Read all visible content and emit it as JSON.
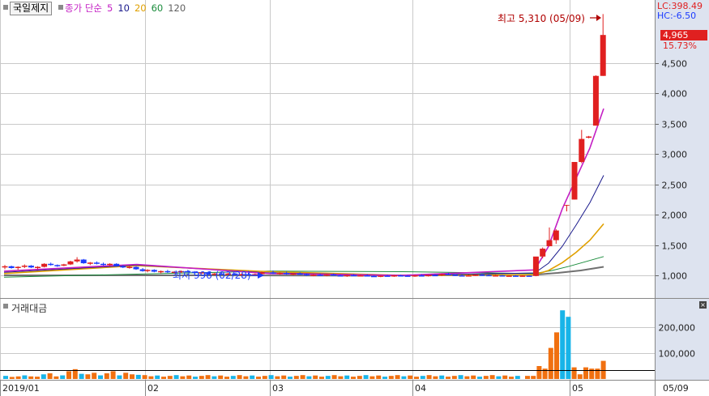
{
  "header": {
    "stock_name": "국일제지",
    "ma_label": "종가 단순",
    "periods": [
      {
        "label": "5",
        "color": "#c41fc4"
      },
      {
        "label": "10",
        "color": "#1a1a8c"
      },
      {
        "label": "20",
        "color": "#e0a000"
      },
      {
        "label": "60",
        "color": "#1a8c3c"
      },
      {
        "label": "120",
        "color": "#606060"
      }
    ]
  },
  "info": {
    "lc": "LC:398.49",
    "hc": "HC:-6.50",
    "current_price": "4,965",
    "change_pct": "15.73%",
    "high_label": "최고 5,310 (05/09)",
    "low_label": "최저 996 (02/28)"
  },
  "volume_panel": {
    "title": "거래대금"
  },
  "colors": {
    "up": "#e02020",
    "down": "#1c3cff",
    "grid": "#c9c9c9",
    "axis_bg": "#dde3ef"
  },
  "chart_data": {
    "type": "candlestick",
    "title": "",
    "x_ticks": [
      "2019/01",
      "02",
      "03",
      "04",
      "05",
      "05/09"
    ],
    "price_axis": {
      "ticks": [
        1000,
        1500,
        2000,
        2500,
        3000,
        3500,
        4000,
        4500
      ],
      "range": [
        700,
        5400
      ]
    },
    "volume_axis": {
      "ticks": [
        100000,
        200000
      ],
      "range": [
        0,
        285000
      ]
    },
    "candles_jan": [
      [
        1130,
        1170,
        1100,
        1150
      ],
      [
        1150,
        1160,
        1110,
        1120
      ],
      [
        1120,
        1150,
        1090,
        1140
      ],
      [
        1140,
        1180,
        1120,
        1160
      ],
      [
        1160,
        1170,
        1120,
        1130
      ],
      [
        1130,
        1150,
        1100,
        1140
      ],
      [
        1140,
        1200,
        1130,
        1190
      ],
      [
        1190,
        1210,
        1160,
        1170
      ],
      [
        1170,
        1180,
        1140,
        1160
      ],
      [
        1160,
        1190,
        1150,
        1180
      ],
      [
        1180,
        1240,
        1170,
        1230
      ],
      [
        1230,
        1300,
        1210,
        1260
      ],
      [
        1260,
        1270,
        1190,
        1200
      ],
      [
        1200,
        1220,
        1170,
        1210
      ],
      [
        1210,
        1230,
        1180,
        1190
      ],
      [
        1190,
        1210,
        1160,
        1170
      ],
      [
        1170,
        1200,
        1150,
        1190
      ],
      [
        1190,
        1200,
        1140,
        1150
      ],
      [
        1150,
        1170,
        1120,
        1130
      ],
      [
        1130,
        1160,
        1110,
        1140
      ],
      [
        1140,
        1150,
        1090,
        1100
      ],
      [
        1100,
        1120,
        1060,
        1070
      ]
    ],
    "candles_feb": [
      [
        1070,
        1100,
        1050,
        1090
      ],
      [
        1090,
        1100,
        1050,
        1060
      ],
      [
        1060,
        1080,
        1030,
        1070
      ],
      [
        1070,
        1090,
        1040,
        1050
      ],
      [
        1050,
        1070,
        1030,
        1060
      ],
      [
        1060,
        1080,
        1040,
        1070
      ],
      [
        1070,
        1090,
        1050,
        1060
      ],
      [
        1060,
        1070,
        1030,
        1040
      ],
      [
        1040,
        1060,
        1020,
        1050
      ],
      [
        1050,
        1060,
        1010,
        1020
      ],
      [
        1020,
        1040,
        1000,
        1030
      ],
      [
        1030,
        1050,
        1010,
        1020
      ],
      [
        1020,
        1040,
        1000,
        1030
      ],
      [
        1030,
        1040,
        996,
        1005
      ],
      [
        1005,
        1030,
        996,
        1020
      ],
      [
        1020,
        1040,
        1000,
        1010
      ],
      [
        1010,
        1030,
        995,
        1020
      ],
      [
        1020,
        1060,
        1000,
        1050
      ]
    ],
    "candles_mar": [
      [
        1050,
        1080,
        1020,
        1030
      ],
      [
        1030,
        1050,
        1010,
        1040
      ],
      [
        1040,
        1060,
        1010,
        1020
      ],
      [
        1020,
        1040,
        1000,
        1030
      ],
      [
        1030,
        1050,
        1010,
        1020
      ],
      [
        1020,
        1030,
        990,
        1000
      ],
      [
        1000,
        1020,
        985,
        1010
      ],
      [
        1010,
        1030,
        990,
        1000
      ],
      [
        1000,
        1020,
        985,
        1015
      ],
      [
        1015,
        1030,
        995,
        1000
      ],
      [
        1000,
        1010,
        980,
        990
      ],
      [
        990,
        1010,
        975,
        1005
      ],
      [
        1005,
        1020,
        990,
        995
      ],
      [
        995,
        1010,
        980,
        1000
      ],
      [
        1000,
        1020,
        985,
        990
      ],
      [
        990,
        1000,
        975,
        985
      ],
      [
        985,
        1000,
        970,
        995
      ],
      [
        995,
        1010,
        980,
        990
      ],
      [
        990,
        1005,
        975,
        1000
      ],
      [
        1000,
        1010,
        985,
        995
      ],
      [
        995,
        1005,
        980,
        990
      ]
    ],
    "candles_apr": [
      [
        990,
        1010,
        975,
        1000
      ],
      [
        1000,
        1020,
        985,
        995
      ],
      [
        995,
        1010,
        980,
        1005
      ],
      [
        1005,
        1020,
        990,
        1000
      ],
      [
        1000,
        1030,
        990,
        1020
      ],
      [
        1020,
        1040,
        1000,
        1010
      ],
      [
        1010,
        1020,
        990,
        1000
      ],
      [
        1000,
        1015,
        985,
        995
      ],
      [
        995,
        1010,
        980,
        1000
      ],
      [
        1000,
        1020,
        990,
        1010
      ],
      [
        1010,
        1030,
        995,
        1005
      ],
      [
        1005,
        1015,
        990,
        995
      ],
      [
        995,
        1010,
        985,
        1000
      ],
      [
        1000,
        1005,
        985,
        990
      ],
      [
        990,
        1000,
        980,
        995
      ],
      [
        995,
        1005,
        985,
        990
      ],
      [
        990,
        1000,
        980,
        995
      ],
      [
        995,
        1000,
        985,
        990
      ],
      [
        990,
        1030,
        985,
        1310
      ],
      [
        1310,
        1460,
        1280,
        1440
      ],
      [
        1480,
        1790,
        1480,
        1580
      ],
      [
        1580,
        1760,
        1520,
        1740
      ]
    ],
    "candles_may": [
      [
        2250,
        2870,
        2250,
        2870
      ],
      [
        2870,
        3400,
        2850,
        3250
      ],
      [
        3280,
        3300,
        3260,
        3290
      ],
      [
        3470,
        4300,
        3470,
        4290
      ],
      [
        4290,
        5310,
        4290,
        4965
      ]
    ],
    "ma": {
      "ma5": {
        "start": 1000,
        "values": [
          1090,
          1480,
          2100,
          2600,
          3100,
          3750
        ]
      },
      "ma10": {
        "start": 995,
        "values": [
          1040,
          1200,
          1480,
          1830,
          2200,
          2650
        ]
      },
      "ma20": {
        "start": 993,
        "values": [
          1010,
          1080,
          1210,
          1380,
          1580,
          1850
        ]
      },
      "ma60": {
        "start": 1000,
        "values": [
          1030,
          1080,
          1150,
          1230,
          1310
        ]
      },
      "ma120": {
        "start": 995,
        "values": [
          1010,
          1040,
          1080,
          1140
        ]
      }
    },
    "volume_level": 35000,
    "volume_early": [
      12000,
      8000,
      10000,
      14000,
      10000,
      9000,
      18000,
      22000,
      10000,
      14000,
      30000,
      38000,
      20000,
      18000,
      24000,
      14000,
      22000,
      30000,
      14000,
      24000,
      18000,
      16000
    ],
    "volume_surge": [
      12000,
      12000,
      50000,
      40000,
      120000,
      180000,
      265000,
      240000,
      45000,
      18000,
      45000,
      40000,
      40000,
      70000
    ]
  }
}
